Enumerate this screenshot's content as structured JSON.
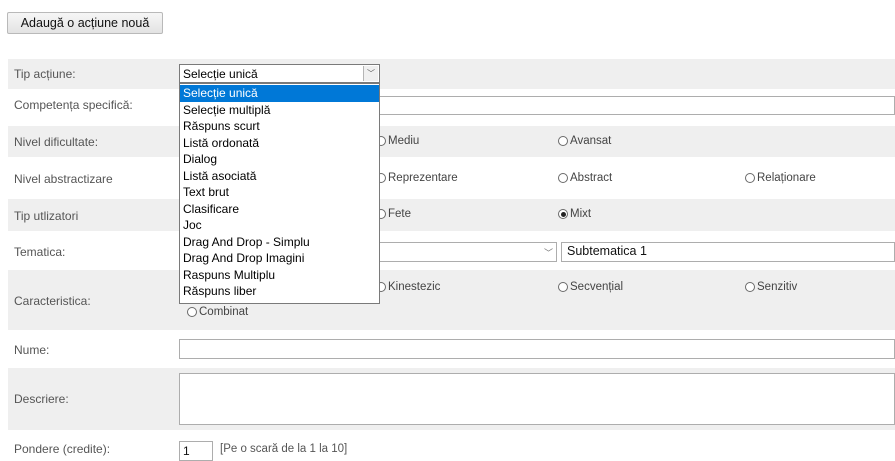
{
  "add_button_label": "Adaugă o acțiune nouă",
  "form": {
    "tip_actiune": {
      "label": "Tip acțiune:",
      "selected": "Selecție unică"
    },
    "competenta": {
      "label": "Competența specifică:"
    },
    "nivel_dificultate": {
      "label": "Nivel dificultate:",
      "options": [
        "Mediu",
        "Avansat"
      ]
    },
    "nivel_abstractizare": {
      "label": "Nivel abstractizare",
      "options": [
        "Reprezentare",
        "Abstract",
        "Relaționare"
      ]
    },
    "tip_utilizatori": {
      "label": "Tip utlizatori",
      "options": [
        "Fete",
        "Mixt"
      ],
      "checked": "Mixt"
    },
    "tematica": {
      "label": "Tematica:",
      "subtematica_value": "Subtematica 1"
    },
    "caracteristica": {
      "label": "Caracteristica:",
      "options": [
        "Kinestezic",
        "Secvențial",
        "Senzitiv",
        "Combinat"
      ]
    },
    "nume": {
      "label": "Nume:",
      "value": ""
    },
    "descriere": {
      "label": "Descriere:",
      "value": ""
    },
    "pondere": {
      "label": "Pondere (credite):",
      "value": "1",
      "hint": "[Pe o scară de la 1 la 10]"
    }
  },
  "dropdown_options": [
    "Selecție unică",
    "Selecție multiplă",
    "Răspuns scurt",
    "Listă ordonată",
    "Dialog",
    "Listă asociată",
    "Text brut",
    "Clasificare",
    "Joc",
    "Drag And Drop - Simplu",
    "Drag And Drop Imagini",
    "Raspuns Multiplu",
    "Răspuns liber"
  ],
  "dropdown_selected_index": 0
}
